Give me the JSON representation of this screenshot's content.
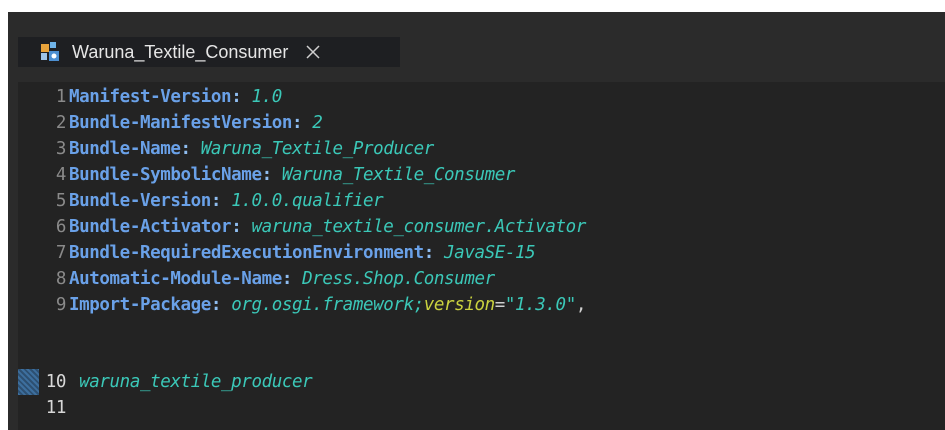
{
  "tab": {
    "title": "Waruna_Textile_Consumer",
    "icon": "plugin-manifest-icon",
    "close_icon": "close-icon"
  },
  "editor": {
    "lines": [
      {
        "num": "1",
        "key": "Manifest-Version",
        "sep": ": ",
        "value": "1.0"
      },
      {
        "num": "2",
        "key": "Bundle-ManifestVersion",
        "sep": ": ",
        "value": "2"
      },
      {
        "num": "3",
        "key": "Bundle-Name",
        "sep": ": ",
        "value": "Waruna_Textile_Producer"
      },
      {
        "num": "4",
        "key": "Bundle-SymbolicName",
        "sep": ": ",
        "value": "Waruna_Textile_Consumer"
      },
      {
        "num": "5",
        "key": "Bundle-Version",
        "sep": ": ",
        "value": "1.0.0.qualifier"
      },
      {
        "num": "6",
        "key": "Bundle-Activator",
        "sep": ": ",
        "value": "waruna_textile_consumer.Activator"
      },
      {
        "num": "7",
        "key": "Bundle-RequiredExecutionEnvironment",
        "sep": ": ",
        "value": "JavaSE-15"
      },
      {
        "num": "8",
        "key": "Automatic-Module-Name",
        "sep": ": ",
        "value": "Dress.Shop.Consumer"
      },
      {
        "num": "9",
        "key": "Import-Package",
        "sep": ": ",
        "value": "org.osgi.framework;",
        "attr": "version",
        "eq": "=",
        "str": "\"1.3.0\"",
        "tail": ","
      },
      {
        "num": "10",
        "value": " waruna_textile_producer"
      },
      {
        "num": "11"
      }
    ]
  },
  "colors": {
    "background": "#2b2b2b",
    "editor_background": "#232323",
    "key": "#6aa1e8",
    "value": "#3bc8b8",
    "attribute": "#cad23f",
    "line_number": "#8a8a8a"
  }
}
